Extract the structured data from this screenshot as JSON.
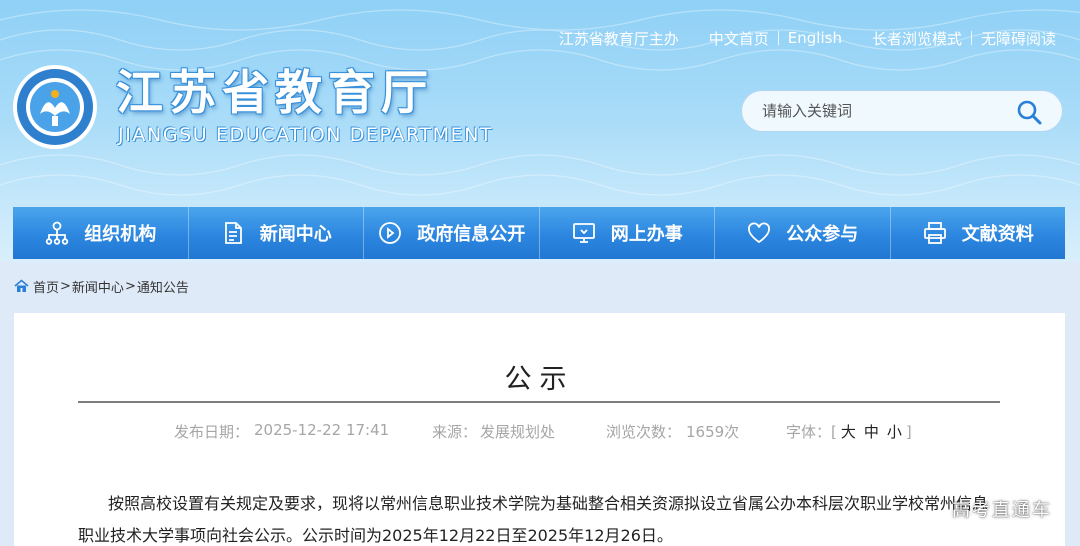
{
  "header": {
    "top_links": {
      "host": "江苏省教育厅主办",
      "home_cn": "中文首页",
      "english": "English",
      "elder_mode": "长者浏览模式",
      "accessible": "无障碍阅读"
    },
    "title": "江苏省教育厅",
    "subtitle": "JIANGSU EDUCATION DEPARTMENT",
    "search": {
      "placeholder": "请输入关键词"
    },
    "colors": {
      "accent": "#2c86df",
      "header_bg": "#a9dcf8"
    }
  },
  "nav": {
    "items": [
      {
        "label": "组织机构",
        "icon": "org-chart-icon"
      },
      {
        "label": "新闻中心",
        "icon": "document-icon"
      },
      {
        "label": "政府信息公开",
        "icon": "play-circle-icon"
      },
      {
        "label": "网上办事",
        "icon": "monitor-icon"
      },
      {
        "label": "公众参与",
        "icon": "heart-icon"
      },
      {
        "label": "文献资料",
        "icon": "printer-icon"
      }
    ]
  },
  "breadcrumb": {
    "home": "首页",
    "sep1": ">",
    "news": "新闻中心",
    "sep2": ">",
    "notice": "通知公告"
  },
  "article": {
    "title": "公示",
    "meta": {
      "date_label": "发布日期：",
      "date": "2025-12-22 17:41",
      "source_label": "来源：",
      "source": "发展规划处",
      "views_label": "浏览次数：",
      "views": "1659次",
      "font_label": "字体：",
      "font_open": "[",
      "font_large": "大",
      "font_medium": "中",
      "font_small": "小",
      "font_close": "]"
    },
    "body": "按照高校设置有关规定及要求，现将以常州信息职业技术学院为基础整合相关资源拟设立省属公办本科层次职业学校常州信息职业技术大学事项向社会公示。公示时间为2025年12月22日至2025年12月26日。"
  },
  "watermark": "高考直通车"
}
